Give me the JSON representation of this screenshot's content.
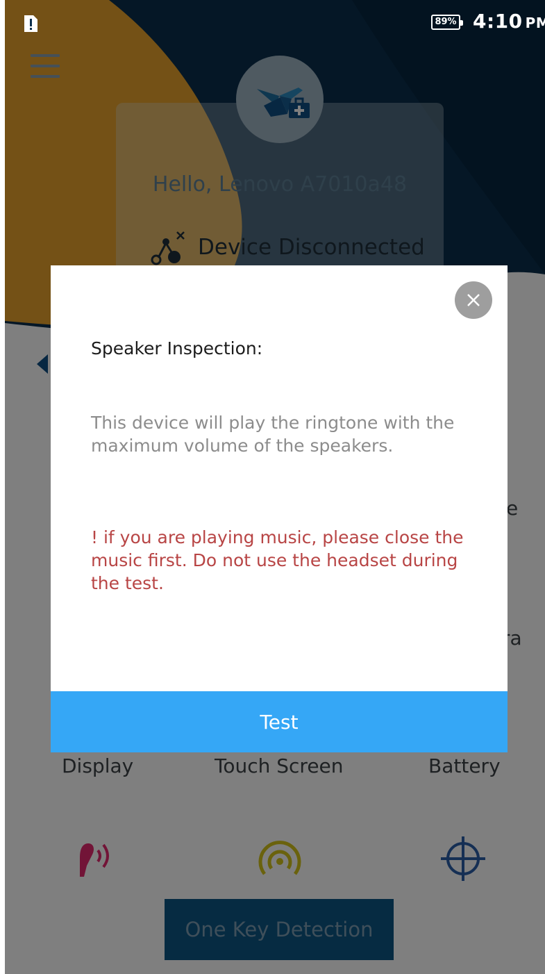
{
  "status_bar": {
    "battery": "89%",
    "time": "4:10",
    "ampm": "PM"
  },
  "header": {
    "greeting": "Hello, Lenovo A7010a48",
    "connection_status": "Device Disconnected"
  },
  "background": {
    "peek_right_1": "e",
    "peek_right_2": "ra",
    "grid_labels": [
      "Display",
      "Touch Screen",
      "Battery"
    ],
    "one_key_button": "One Key Detection"
  },
  "dialog": {
    "title": "Speaker Inspection:",
    "body": "This device will play the ringtone with the maximum volume of the speakers.",
    "warning": "!  if you are playing music, please close the music first. Do not use the headset during the test.",
    "primary_button": "Test"
  },
  "colors": {
    "navy": "#0b2f4d",
    "orange": "#e8a22c",
    "test_button": "#35a7f6",
    "warning_text": "#b84545"
  },
  "icons": [
    "menu-icon",
    "app-logo-icon",
    "disconnected-icon",
    "close-icon",
    "earphone-icon",
    "signal-icon",
    "crosshair-icon"
  ]
}
